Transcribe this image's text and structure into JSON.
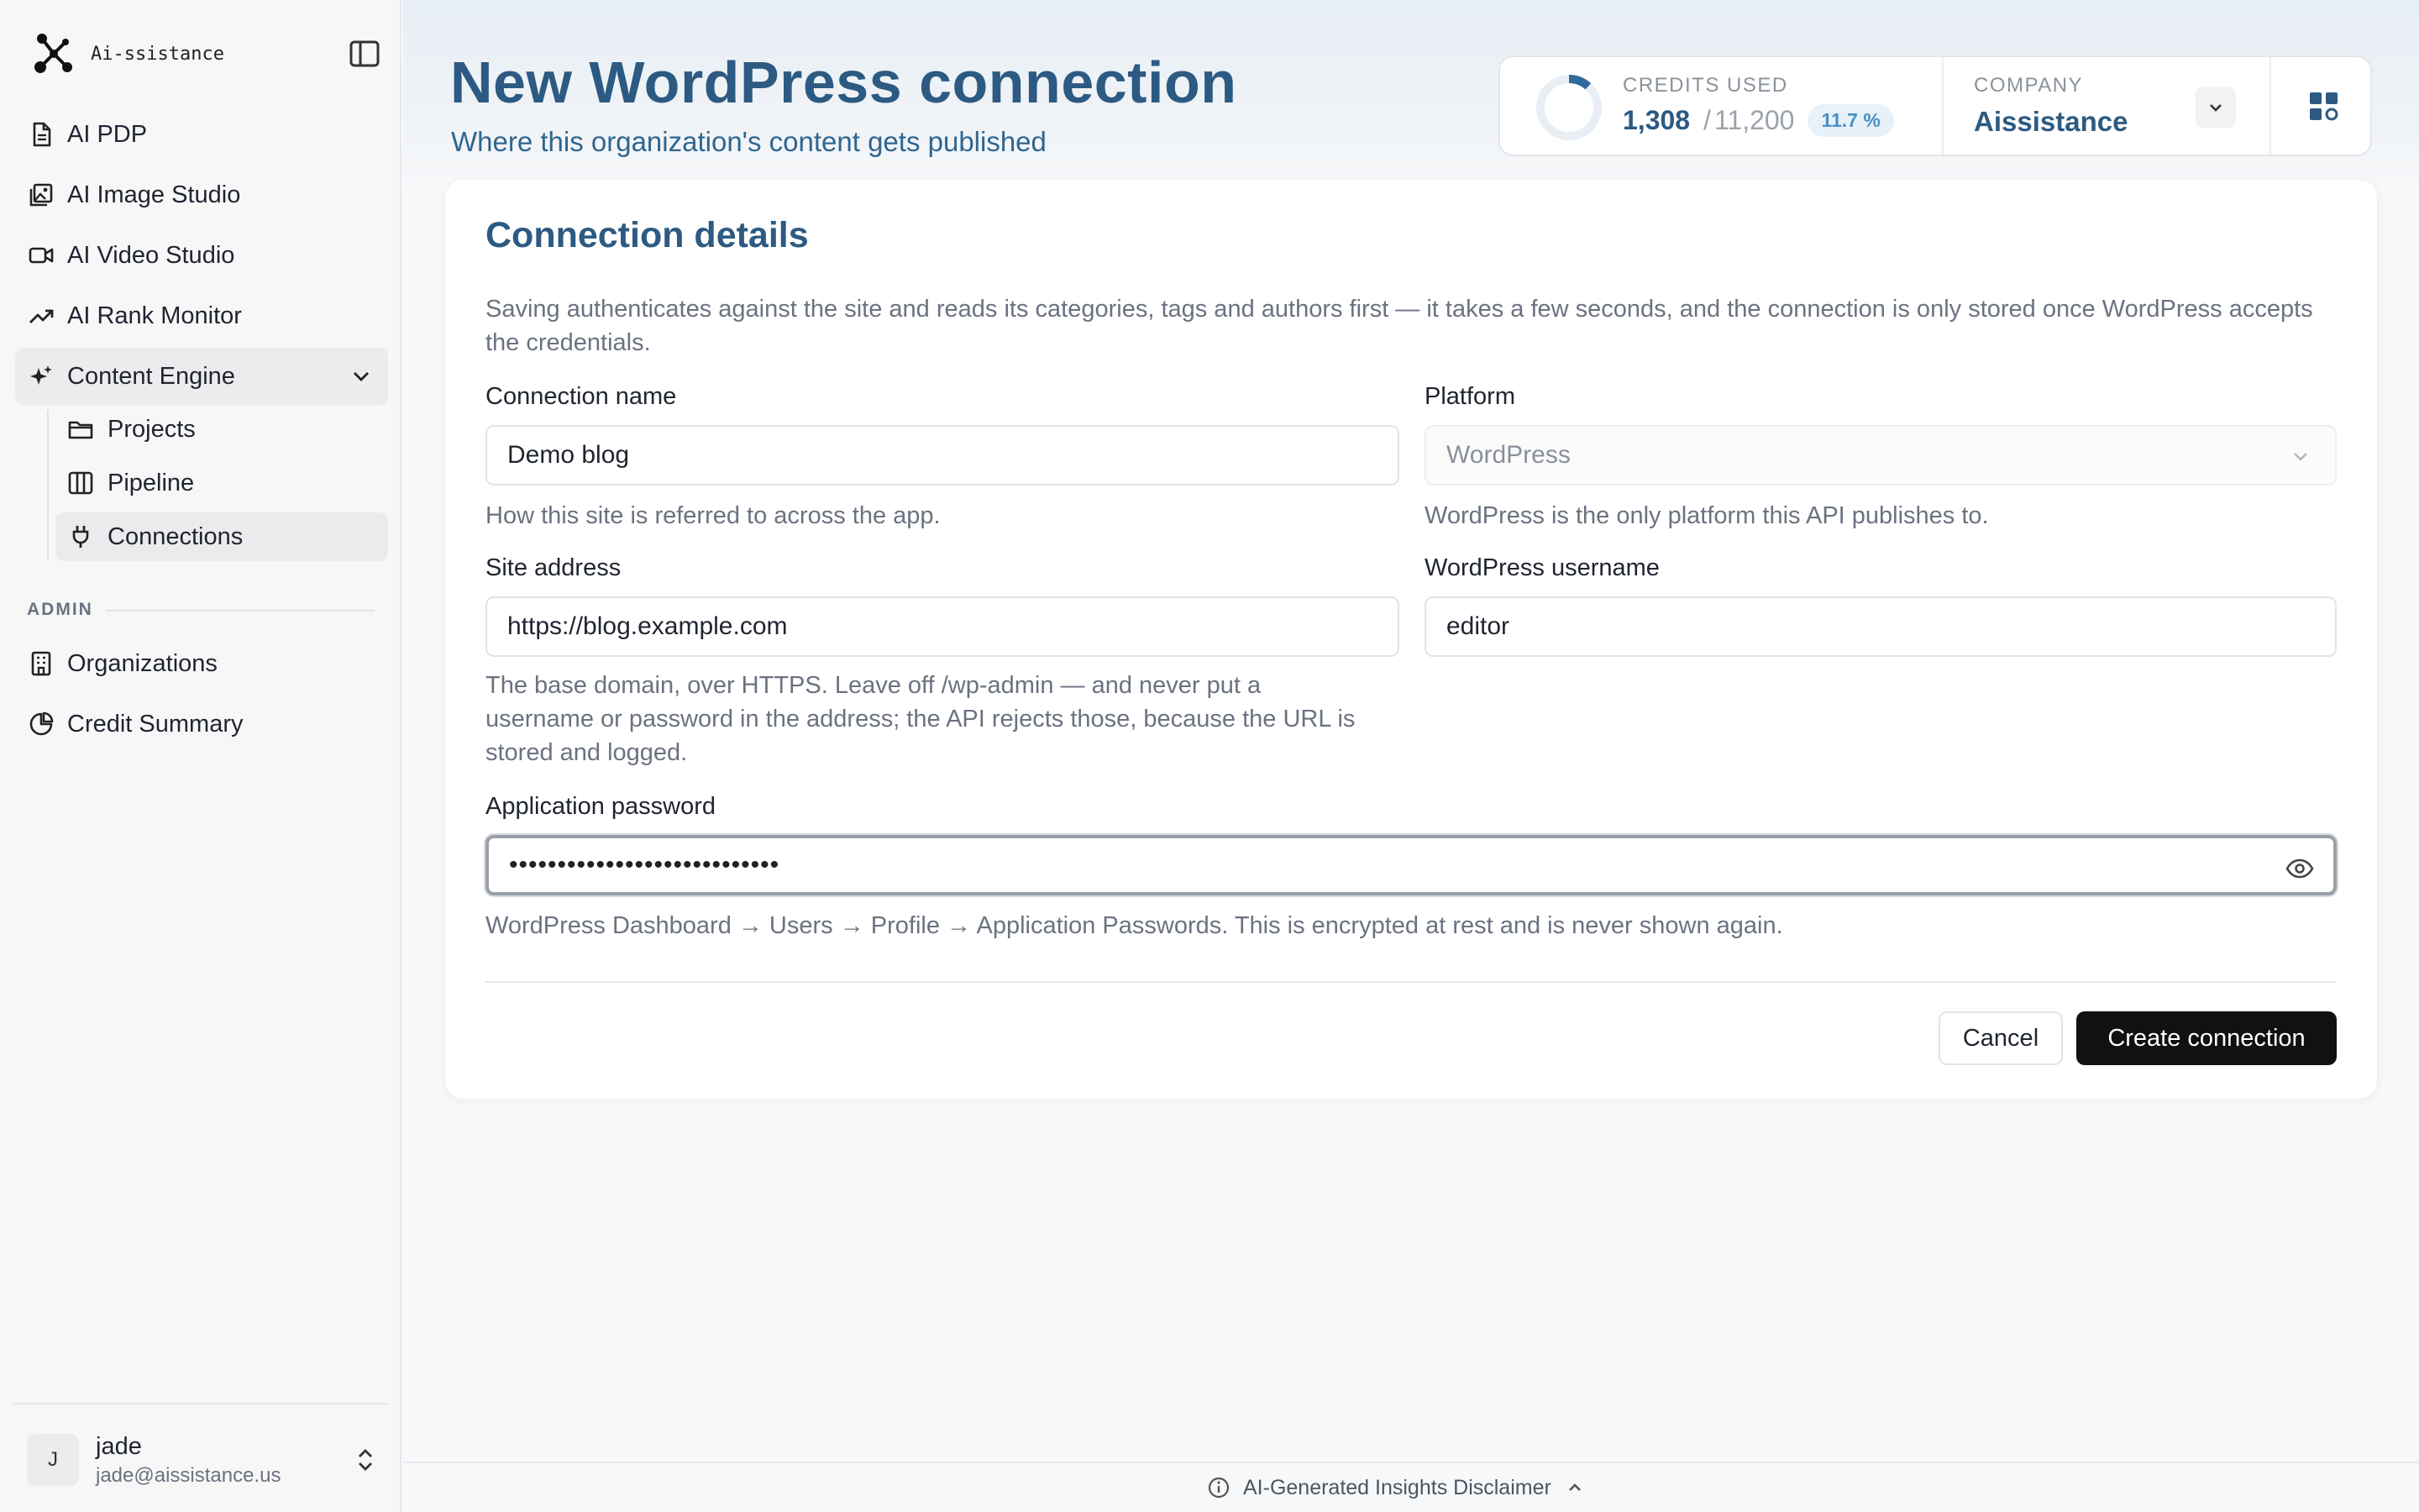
{
  "app": {
    "brand": "Ai-ssistance"
  },
  "sidebar": {
    "items": [
      {
        "label": "AI PDP",
        "icon": "document-icon"
      },
      {
        "label": "AI Image Studio",
        "icon": "image-icon"
      },
      {
        "label": "AI Video Studio",
        "icon": "video-icon"
      },
      {
        "label": "AI Rank Monitor",
        "icon": "trend-icon"
      },
      {
        "label": "Content Engine",
        "icon": "sparkle-icon",
        "expanded": true
      }
    ],
    "sub_items": [
      {
        "label": "Projects",
        "icon": "folder-icon"
      },
      {
        "label": "Pipeline",
        "icon": "columns-icon"
      },
      {
        "label": "Connections",
        "icon": "plug-icon",
        "selected": true
      }
    ],
    "admin_label": "ADMIN",
    "admin_items": [
      {
        "label": "Organizations",
        "icon": "building-icon"
      },
      {
        "label": "Credit Summary",
        "icon": "pie-icon"
      }
    ],
    "user": {
      "initial": "J",
      "name": "jade",
      "email": "jade@aissistance.us"
    }
  },
  "header": {
    "title": "New WordPress connection",
    "subtitle": "Where this organization's content gets published"
  },
  "stats": {
    "credits_label": "CREDITS USED",
    "credits_used": "1,308",
    "credits_sep": "/",
    "credits_total": "11,200",
    "credits_percent": "11.7 %",
    "credits_fraction": 0.117,
    "company_label": "COMPANY",
    "company_name": "Aissistance"
  },
  "form": {
    "title": "Connection details",
    "intro": "Saving authenticates against the site and reads its categories, tags and authors first — it takes a few seconds, and the connection is only stored once WordPress accepts the credentials.",
    "connection_name": {
      "label": "Connection name",
      "value": "Demo blog",
      "helper": "How this site is referred to across the app."
    },
    "platform": {
      "label": "Platform",
      "value": "WordPress",
      "helper": "WordPress is the only platform this API publishes to."
    },
    "site_address": {
      "label": "Site address",
      "value": "https://blog.example.com",
      "helper": "The base domain, over HTTPS. Leave off /wp-admin — and never put a username or password in the address; the API rejects those, because the URL is stored and logged."
    },
    "username": {
      "label": "WordPress username",
      "value": "editor"
    },
    "password": {
      "label": "Application password",
      "value": "••••••••••••••••••••••••••••",
      "helper": "WordPress Dashboard → Users → Profile → Application Passwords. This is encrypted at rest and is never shown again."
    },
    "cancel_label": "Cancel",
    "submit_label": "Create connection"
  },
  "footer": {
    "disclaimer": "AI-Generated Insights Disclaimer"
  },
  "colors": {
    "accent": "#2c5a82",
    "donut": "#2f6a9a",
    "primary_button": "#111111"
  }
}
